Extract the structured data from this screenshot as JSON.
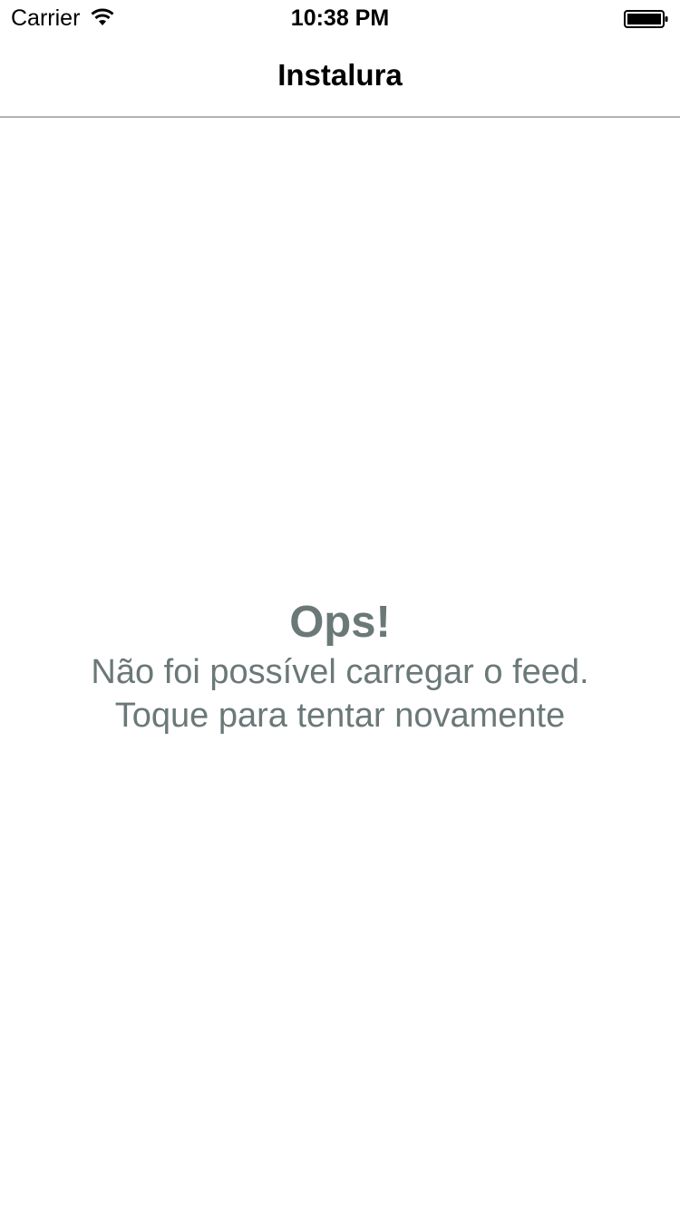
{
  "status_bar": {
    "carrier": "Carrier",
    "time": "10:38 PM",
    "wifi_icon": "wifi-icon",
    "battery_icon": "battery-icon"
  },
  "nav": {
    "title": "Instalura"
  },
  "error": {
    "heading": "Ops!",
    "line1": "Não foi possível carregar o feed.",
    "line2": "Toque para tentar novamente",
    "color": "#6b7878"
  }
}
